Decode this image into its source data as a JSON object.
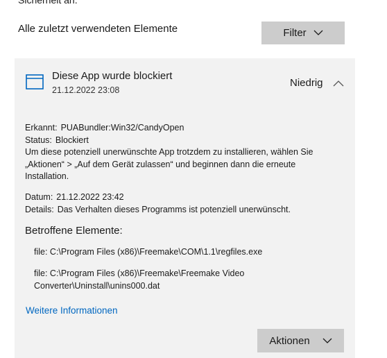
{
  "top_cut_text": "Sicherheit an.",
  "recent_label": "Alle zuletzt verwendeten Elemente",
  "filter_button": {
    "label": "Filter"
  },
  "card": {
    "title": "Diese App wurde blockiert",
    "date": "21.12.2022 23:08",
    "severity": "Niedrig",
    "detected_label": "Erkannt:",
    "detected_value": "PUABundler:Win32/CandyOpen",
    "status_label": "Status:",
    "status_value": "Blockiert",
    "description": "Um diese potenziell unerwünschte App trotzdem zu installieren, wählen Sie „Aktionen“ > „Auf dem Gerät zulassen“ und beginnen dann die erneute Installation.",
    "date_label": "Datum:",
    "date_value": "21.12.2022 23:42",
    "details_label": "Details:",
    "details_value": "Das Verhalten dieses Programms ist potenziell unerwünscht.",
    "affected_heading": "Betroffene Elemente:",
    "affected_items": [
      "file: C:\\Program Files (x86)\\Freemake\\COM\\1.1\\regfiles.exe",
      "file: C:\\Program Files (x86)\\Freemake\\Freemake Video Converter\\Uninstall\\unins000.dat"
    ],
    "more_info_link": "Weitere Informationen",
    "actions_button": "Aktionen"
  },
  "colors": {
    "card_bg": "#f2f2f2",
    "button_bg": "#cccccc",
    "link": "#0067c0",
    "icon_accent": "#0067c0"
  }
}
